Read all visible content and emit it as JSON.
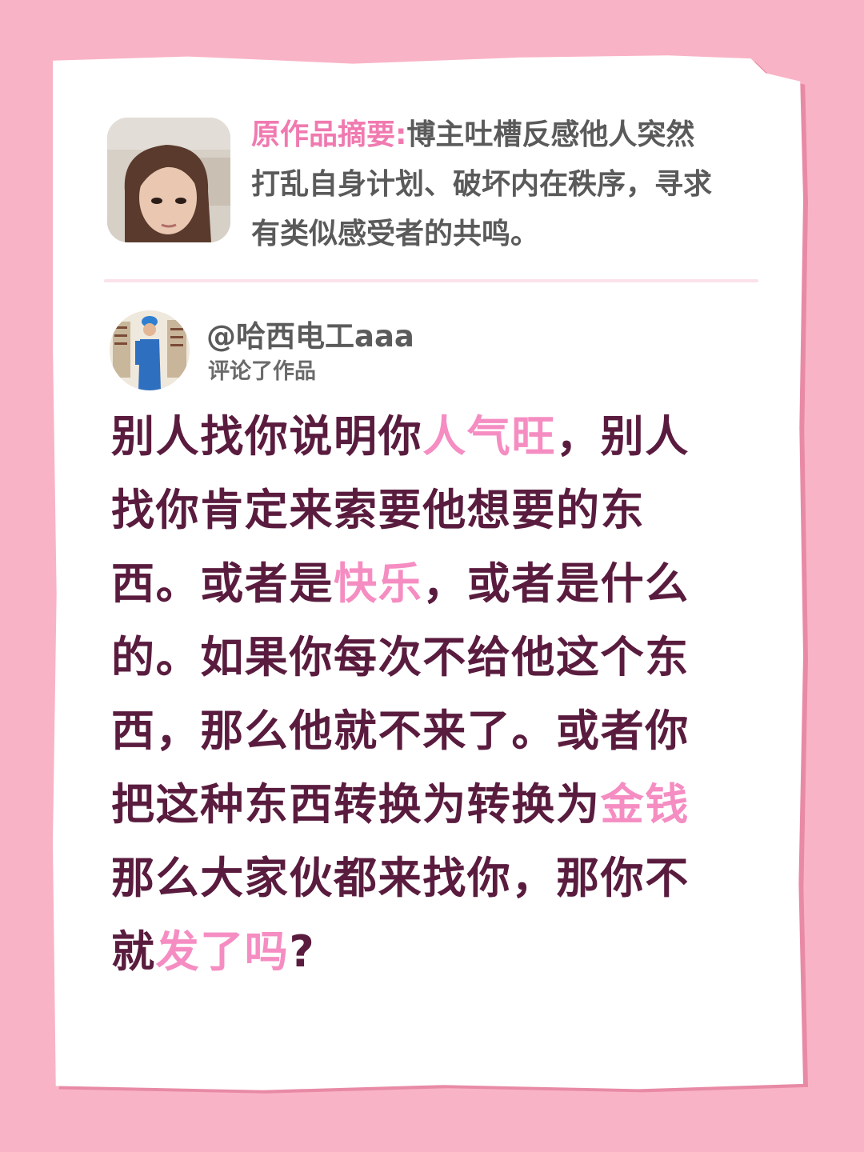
{
  "summary": {
    "label": "原作品摘要:",
    "text_line1": "博主吐槽反感他人突然",
    "text_line2": "打乱自身计划、破坏内在秩序，寻求",
    "text_line3": "有类似感受者的共鸣。"
  },
  "commenter": {
    "handle": "@哈西电工aaa",
    "action": "评论了作品"
  },
  "comment": {
    "l1": [
      "别人找你说明你",
      "人气旺",
      "，别人"
    ],
    "l2": [
      "找你肯定来索要他想要的东"
    ],
    "l3": [
      "西。或者是",
      "快乐",
      "，或者是什么"
    ],
    "l4": [
      "的。如果你每次不给他这个东"
    ],
    "l5": [
      "西，那么他就不来了。或者你"
    ],
    "l6": [
      "把这种东西转换为转换为",
      "金钱"
    ],
    "l7": [
      "那么大家伙都来找你，那你不"
    ],
    "l8": [
      "就",
      "发了吗",
      "?"
    ]
  },
  "colors": {
    "background": "#f9b3c6",
    "card": "#ffffff",
    "label_pink": "#f07ab0",
    "highlight_pink": "#f58dc2",
    "comment_text": "#5a1c3e",
    "meta_text": "#5a5a5a"
  }
}
